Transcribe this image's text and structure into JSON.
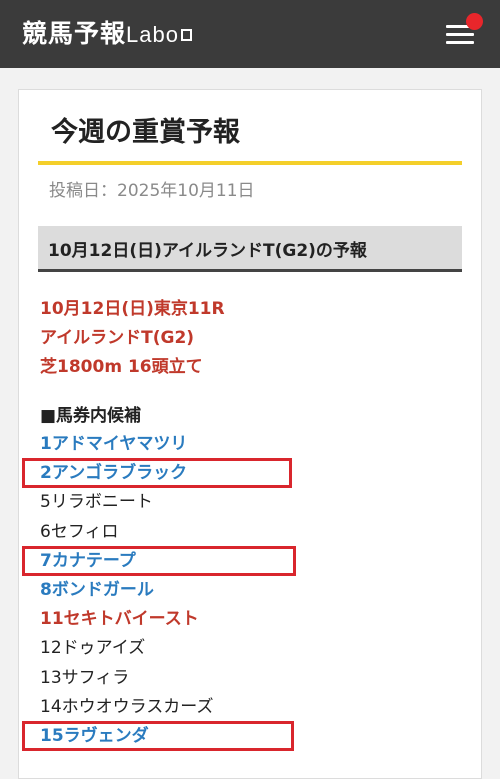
{
  "header": {
    "brand_jp": "競馬予報",
    "brand_latin": "Labo",
    "menu_icon": "hamburger-menu-icon",
    "notification_color": "#e8262b"
  },
  "article": {
    "title": "今週の重賞予報",
    "date_label": "投稿日：",
    "date_value": "2025年10月11日",
    "section_heading": "10月12日(日)アイルランドT(G2)の予報",
    "race_info": [
      "10月12日(日)東京11R",
      "アイルランドT(G2)",
      "芝1800m 16頭立て"
    ],
    "candidates_heading": "■馬券内候補",
    "horses": [
      {
        "label": "1アドマイヤマツリ",
        "style": "blue",
        "highlighted": false
      },
      {
        "label": "2アンゴラブラック",
        "style": "blue",
        "highlighted": true
      },
      {
        "label": "5リラボニート",
        "style": "black",
        "highlighted": false
      },
      {
        "label": "6セフィロ",
        "style": "black",
        "highlighted": false
      },
      {
        "label": "7カナテープ",
        "style": "blue",
        "highlighted": true
      },
      {
        "label": "8ボンドガール",
        "style": "blue",
        "highlighted": false
      },
      {
        "label": "11セキトバイースト",
        "style": "red",
        "highlighted": false
      },
      {
        "label": "12ドゥアイズ",
        "style": "black",
        "highlighted": false
      },
      {
        "label": "13サフィラ",
        "style": "black",
        "highlighted": false
      },
      {
        "label": "14ホウオウラスカーズ",
        "style": "black",
        "highlighted": false
      },
      {
        "label": "15ラヴェンダ",
        "style": "blue",
        "highlighted": true
      }
    ]
  },
  "colors": {
    "accent_yellow": "#f4cf2a",
    "link_blue": "#2a7bbf",
    "emphasis_red": "#c0392b",
    "highlight_box": "#d9262d"
  }
}
